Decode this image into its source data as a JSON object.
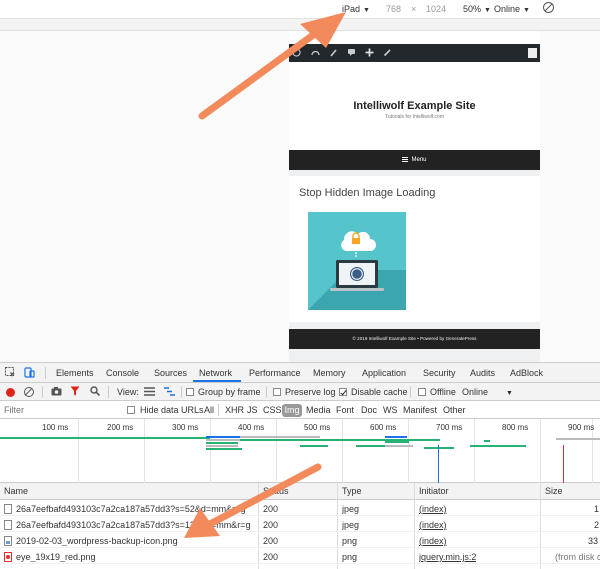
{
  "device_toolbar": {
    "device": "iPad",
    "width": "768",
    "times": "×",
    "height": "1024",
    "zoom": "50%",
    "throttling": "Online"
  },
  "site": {
    "title": "Intelliwolf Example Site",
    "tagline": "Tutorials for Intelliwolf.com",
    "menu_label": "Menu",
    "post_title": "Stop Hidden Image Loading",
    "footer": "© 2019 Intelliwolf Example Site • Powered by GeneratePress"
  },
  "devtools": {
    "tabs": [
      "Elements",
      "Console",
      "Sources",
      "Network",
      "Performance",
      "Memory",
      "Application",
      "Security",
      "Audits",
      "AdBlock"
    ],
    "active_tab": "Network",
    "toolbar": {
      "view_label": "View:",
      "group_by_frame": "Group by frame",
      "preserve_log": "Preserve log",
      "disable_cache": "Disable cache",
      "offline": "Offline",
      "online": "Online"
    },
    "filter": {
      "placeholder": "Filter",
      "hide_data_urls": "Hide data URLs",
      "types": [
        "All",
        "XHR",
        "JS",
        "CSS",
        "Img",
        "Media",
        "Font",
        "Doc",
        "WS",
        "Manifest",
        "Other"
      ],
      "active_type": "Img"
    },
    "overview_ticks": [
      "100 ms",
      "200 ms",
      "300 ms",
      "400 ms",
      "500 ms",
      "600 ms",
      "700 ms",
      "800 ms",
      "900 ms"
    ],
    "columns": [
      "Name",
      "Status",
      "Type",
      "Initiator",
      "Size"
    ],
    "rows": [
      {
        "name": "26a7eefbafd493103c7a2ca187a57dd3?s=52&d=mm&r=g",
        "status": "200",
        "type": "jpeg",
        "initiator": "(index)",
        "size": "1"
      },
      {
        "name": "26a7eefbafd493103c7a2ca187a57dd3?s=128&d=mm&r=g",
        "status": "200",
        "type": "jpeg",
        "initiator": "(index)",
        "size": "2"
      },
      {
        "name": "2019-02-03_wordpress-backup-icon.png",
        "status": "200",
        "type": "png",
        "initiator": "(index)",
        "size": "33"
      },
      {
        "name": "eye_19x19_red.png",
        "status": "200",
        "type": "png",
        "initiator": "jquery.min.js:2",
        "size": "(from disk ca"
      }
    ]
  },
  "colors": {
    "arrow": "#f28a5c",
    "record": "#e0251b",
    "active_tab_underline": "#1a73e8",
    "thumb_bg": "#56c4cb"
  }
}
